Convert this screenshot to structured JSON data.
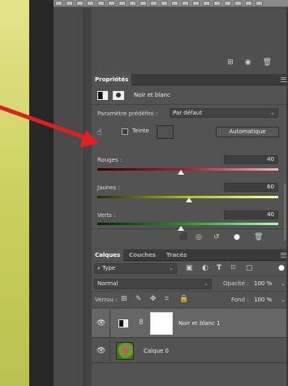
{
  "properties_panel": {
    "tab_label": "Propriétés",
    "adjustment_title": "Noir et blanc",
    "preset_label": "Paramètre prédéfini :",
    "preset_value": "Par défaut",
    "tint_label": "Teinte",
    "auto_label": "Automatique",
    "sliders": [
      {
        "label": "Rouges :",
        "value": "40"
      },
      {
        "label": "Jaunes :",
        "value": "60"
      },
      {
        "label": "Verts :",
        "value": "40"
      }
    ]
  },
  "layers_panel": {
    "tabs": [
      "Calques",
      "Couches",
      "Tracés"
    ],
    "filter_kind": "Type",
    "blend_mode": "Normal",
    "opacity_label": "Opacité :",
    "opacity_value": "100 %",
    "lock_label": "Verrou :",
    "fill_label": "Fond :",
    "fill_value": "100 %",
    "layers": [
      {
        "name": "Noir et blanc 1"
      },
      {
        "name": "Calque 0"
      }
    ]
  },
  "colors": {
    "annotation_arrow": "#e02020",
    "panel_bg": "#535353"
  }
}
